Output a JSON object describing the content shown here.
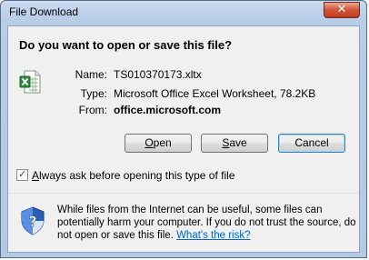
{
  "window": {
    "title": "File Download",
    "close_glyph": "✕"
  },
  "dialog": {
    "question": "Do you want to open or save this file?",
    "file": {
      "icon": "excel-file-icon",
      "name_label": "Name:",
      "name_value": "TS010370173.xltx",
      "type_label": "Type:",
      "type_value": "Microsoft Office Excel Worksheet, 78.2KB",
      "from_label": "From:",
      "from_value": "office.microsoft.com"
    },
    "buttons": {
      "open": {
        "mnemonic": "O",
        "rest": "pen"
      },
      "save": {
        "mnemonic": "S",
        "rest": "ave"
      },
      "cancel": "Cancel"
    },
    "checkbox": {
      "checked": true,
      "mark": "✓",
      "label_mnemonic": "A",
      "label_rest": "lways ask before opening this type of file"
    },
    "warning": {
      "icon": "security-shield-icon",
      "text": "While files from the Internet can be useful, some files can potentially harm your computer. If you do not trust the source, do not open or save this file.",
      "link": "What's the risk?"
    }
  },
  "colors": {
    "titlebar": "#c9daf0",
    "close_button": "#c13a1c",
    "link": "#0066cc"
  }
}
